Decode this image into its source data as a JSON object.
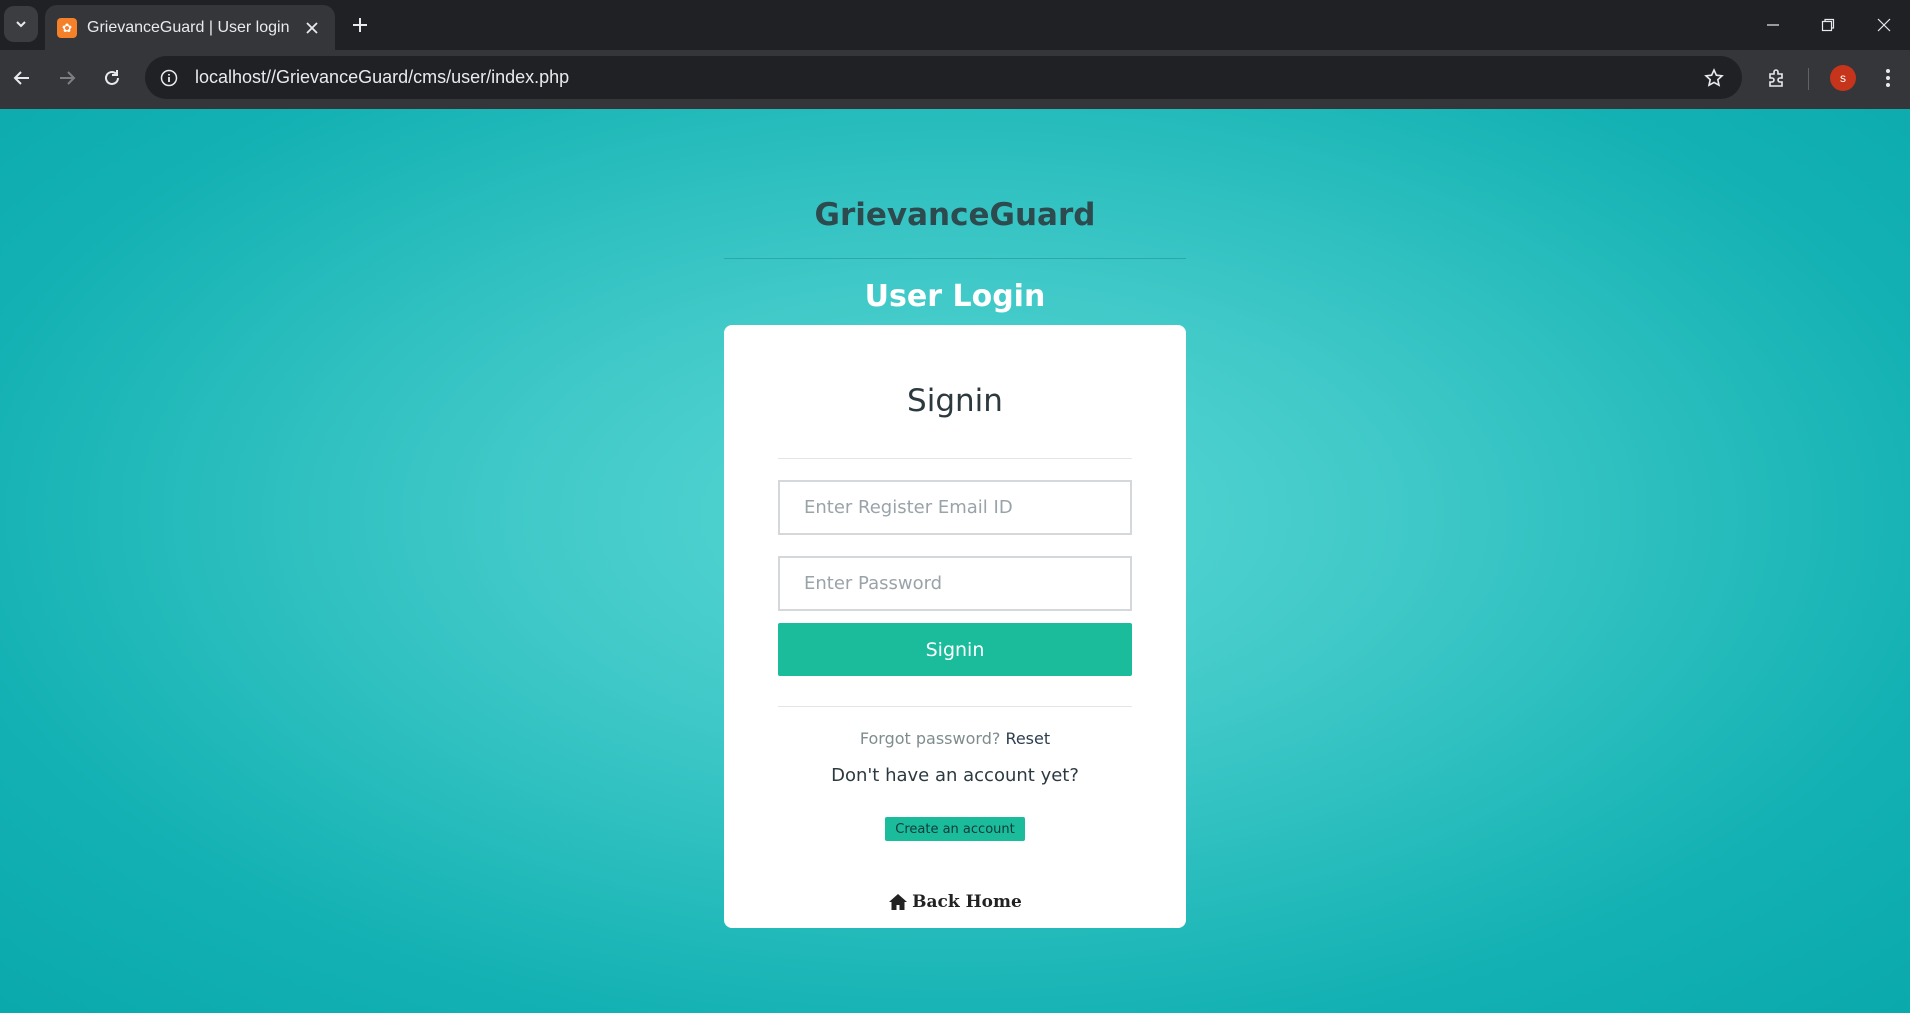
{
  "browser": {
    "tab_title": "GrievanceGuard | User login",
    "favicon_text": "✿",
    "url": "localhost//GrievanceGuard/cms/user/index.php",
    "profile_initial": "s"
  },
  "page": {
    "brand": "GrievanceGuard",
    "subtitle": "User Login",
    "card_title": "Signin",
    "email_placeholder": "Enter Register Email ID",
    "password_placeholder": "Enter Password",
    "signin_button": "Signin",
    "forgot_text": "Forgot password?",
    "reset_link": "Reset",
    "no_account_text": "Don't have an account yet?",
    "create_account_button": "Create an account",
    "back_home_link": "Back Home"
  },
  "colors": {
    "accent": "#1abc9c",
    "background": "#3ec8c7"
  }
}
